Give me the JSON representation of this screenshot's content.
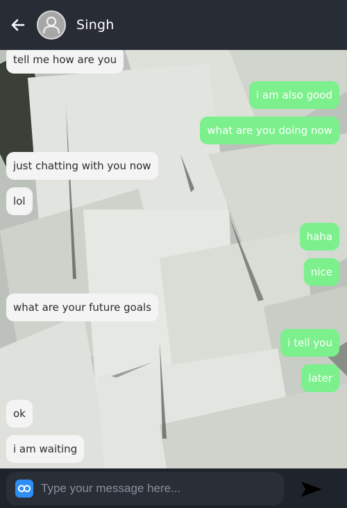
{
  "header": {
    "contact_name": "Singh",
    "back_icon": "arrow-left-icon",
    "avatar_icon": "user-icon"
  },
  "messages": [
    {
      "direction": "in",
      "text": "tell me how are you"
    },
    {
      "direction": "out",
      "text": "i am also good"
    },
    {
      "direction": "out",
      "text": "what are you doing now"
    },
    {
      "direction": "in",
      "text": "just chatting with you now"
    },
    {
      "direction": "in",
      "text": "lol"
    },
    {
      "direction": "out",
      "text": "haha"
    },
    {
      "direction": "out",
      "text": "nice"
    },
    {
      "direction": "in",
      "text": "what are your future goals"
    },
    {
      "direction": "out",
      "text": "i tell you"
    },
    {
      "direction": "out",
      "text": "later"
    },
    {
      "direction": "in",
      "text": "ok"
    },
    {
      "direction": "in",
      "text": "i am waiting"
    }
  ],
  "composer": {
    "placeholder": "Type your message here...",
    "value": "",
    "emoji_icon": "emoji-icon",
    "send_icon": "send-icon"
  },
  "colors": {
    "header_bg": "#282c35",
    "incoming_bubble": "#f4f4f4",
    "outgoing_bubble": "#7bf08c",
    "accent": "#2f8ef6"
  }
}
